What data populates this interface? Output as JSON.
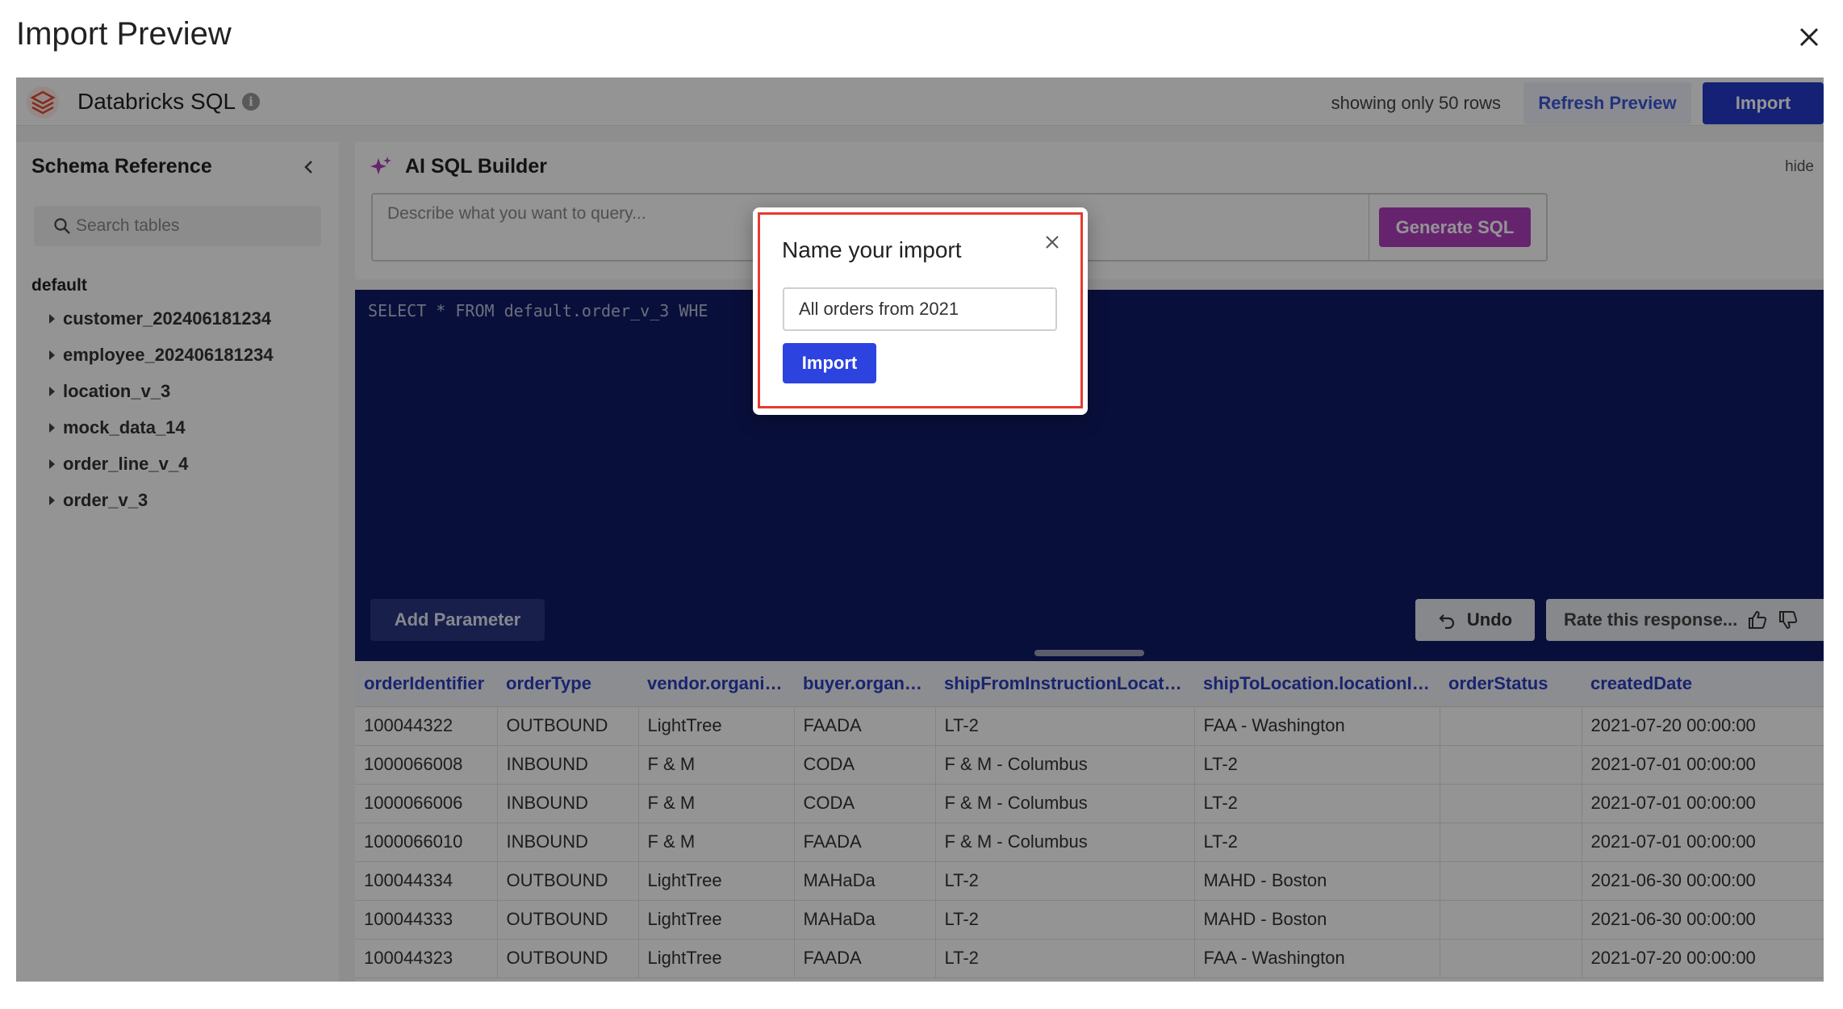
{
  "window": {
    "title": "Import Preview"
  },
  "header": {
    "app_name": "Databricks SQL",
    "rows_note": "showing only 50 rows",
    "refresh_label": "Refresh Preview",
    "import_label": "Import"
  },
  "sidebar": {
    "title": "Schema Reference",
    "search_placeholder": "Search tables",
    "schema": "default",
    "tables": [
      "customer_202406181234",
      "employee_202406181234",
      "location_v_3",
      "mock_data_14",
      "order_line_v_4",
      "order_v_3"
    ]
  },
  "ai_builder": {
    "title": "AI SQL Builder",
    "hide_label": "hide",
    "placeholder": "Describe what you want to query...",
    "generate_label": "Generate SQL"
  },
  "editor": {
    "sql": "SELECT * FROM default.order_v_3 WHE",
    "add_parameter_label": "Add Parameter",
    "undo_label": "Undo",
    "rate_label": "Rate this response..."
  },
  "table": {
    "columns": [
      "orderIdentifier",
      "orderType",
      "vendor.organiz...",
      "buyer.organiz...",
      "shipFromInstructionLocatio...",
      "shipToLocation.locationId...",
      "orderStatus",
      "createdDate"
    ],
    "rows": [
      [
        "100044322",
        "OUTBOUND",
        "LightTree",
        "FAADA",
        "LT-2",
        "FAA - Washington",
        "",
        "2021-07-20 00:00:00"
      ],
      [
        "1000066008",
        "INBOUND",
        "F & M",
        "CODA",
        "F & M - Columbus",
        "LT-2",
        "",
        "2021-07-01 00:00:00"
      ],
      [
        "1000066006",
        "INBOUND",
        "F & M",
        "CODA",
        "F & M - Columbus",
        "LT-2",
        "",
        "2021-07-01 00:00:00"
      ],
      [
        "1000066010",
        "INBOUND",
        "F & M",
        "FAADA",
        "F & M - Columbus",
        "LT-2",
        "",
        "2021-07-01 00:00:00"
      ],
      [
        "100044334",
        "OUTBOUND",
        "LightTree",
        "MAHaDa",
        "LT-2",
        "MAHD - Boston",
        "",
        "2021-06-30 00:00:00"
      ],
      [
        "100044333",
        "OUTBOUND",
        "LightTree",
        "MAHaDa",
        "LT-2",
        "MAHD - Boston",
        "",
        "2021-06-30 00:00:00"
      ],
      [
        "100044323",
        "OUTBOUND",
        "LightTree",
        "FAADA",
        "LT-2",
        "FAA - Washington",
        "",
        "2021-07-20 00:00:00"
      ]
    ]
  },
  "modal": {
    "title": "Name your import",
    "input_value": "All orders from 2021",
    "import_label": "Import"
  },
  "colors": {
    "primary": "#2439c8",
    "generate": "#b03fbf",
    "editor_bg": "#101a66",
    "highlight": "#e53b2e"
  },
  "icons": [
    "close-icon",
    "databricks-logo-icon",
    "info-icon",
    "chevron-left-icon",
    "search-icon",
    "caret-right-icon",
    "sparkle-icon",
    "undo-icon",
    "thumbs-up-icon",
    "thumbs-down-icon"
  ]
}
